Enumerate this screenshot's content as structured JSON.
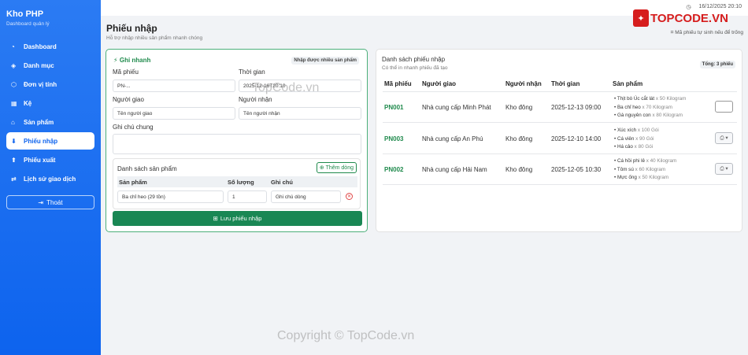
{
  "sidebar": {
    "title": "Kho PHP",
    "subtitle": "Dashboard quản lý",
    "items": [
      {
        "label": "Dashboard",
        "icon": "speedometer-icon"
      },
      {
        "label": "Danh mục",
        "icon": "tags-icon"
      },
      {
        "label": "Đơn vị tính",
        "icon": "box-icon"
      },
      {
        "label": "Kệ",
        "icon": "grid-icon"
      },
      {
        "label": "Sản phẩm",
        "icon": "store-icon"
      },
      {
        "label": "Phiếu nhập",
        "icon": "inbox-icon"
      },
      {
        "label": "Phiếu xuất",
        "icon": "export-icon"
      },
      {
        "label": "Lịch sử giao dịch",
        "icon": "history-icon"
      }
    ],
    "logout": "Thoát"
  },
  "topbar": {
    "datetime": "16/12/2025 20:10",
    "hint": "Mã phiếu tự sinh nếu để trống"
  },
  "brand_watermark": {
    "logo_text": "TOPCODE.VN",
    "center": "TopCode.vn",
    "footer": "Copyright © TopCode.vn"
  },
  "page": {
    "title": "Phiếu nhập",
    "subtitle": "Hỗ trợ nhập nhiều sản phẩm nhanh chóng"
  },
  "form": {
    "quick_label": "Ghi nhanh",
    "multi_tag": "Nhập được nhiều sản phẩm",
    "code_label": "Mã phiếu",
    "code_value": "PN-...",
    "time_label": "Thời gian",
    "time_value": "2025-12-16T20:10",
    "deliverer_label": "Người giao",
    "deliverer_placeholder": "Tên người giao",
    "receiver_label": "Người nhận",
    "receiver_placeholder": "Tên người nhận",
    "note_label": "Ghi chú chung",
    "products_title": "Danh sách sản phẩm",
    "add_row": "Thêm dòng",
    "col_product": "Sản phẩm",
    "col_qty": "Số lượng",
    "col_note": "Ghi chú",
    "row_product": "Ba chỉ heo (29 tồn)",
    "row_qty": "1",
    "row_note_placeholder": "Ghi chú dòng",
    "save": "Lưu phiếu nhập"
  },
  "list": {
    "title": "Danh sách phiếu nhập",
    "subtitle": "Có thể in nhanh phiếu đã tạo",
    "count": "Tổng: 3 phiếu",
    "headers": [
      "Mã phiếu",
      "Người giao",
      "Người nhận",
      "Thời gian",
      "Sản phẩm"
    ],
    "rows": [
      {
        "code": "PN001",
        "deliverer": "Nhà cung cấp Minh Phát",
        "receiver": "Kho đông",
        "time": "2025-12-13 09:00",
        "items": [
          [
            "Thịt bò Úc cắt lát",
            "x 50 Kilogram"
          ],
          [
            "Ba chỉ heo",
            "x 70 Kilogram"
          ],
          [
            "Gà nguyên con",
            "x 80 Kilogram"
          ]
        ]
      },
      {
        "code": "PN003",
        "deliverer": "Nhà cung cấp An Phú",
        "receiver": "Kho đông",
        "time": "2025-12-10 14:00",
        "items": [
          [
            "Xúc xích",
            "x 100 Gói"
          ],
          [
            "Cá viên",
            "x 90 Gói"
          ],
          [
            "Há cảo",
            "x 80 Gói"
          ]
        ]
      },
      {
        "code": "PN002",
        "deliverer": "Nhà cung cấp Hải Nam",
        "receiver": "Kho đông",
        "time": "2025-12-05 10:30",
        "items": [
          [
            "Cá hồi phi lê",
            "x 40 Kilogram"
          ],
          [
            "Tôm sú",
            "x 60 Kilogram"
          ],
          [
            "Mực ống",
            "x 50 Kilogram"
          ]
        ]
      }
    ]
  }
}
